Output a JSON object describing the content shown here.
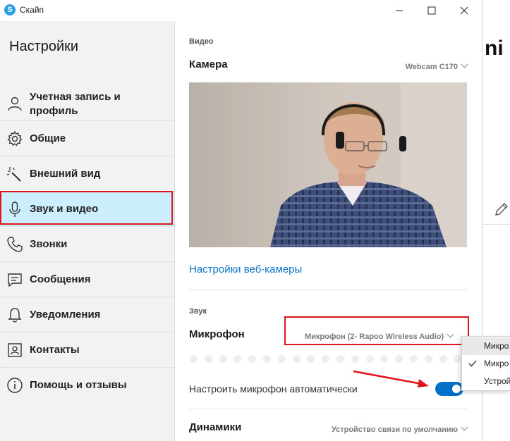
{
  "window": {
    "title": "Скайп",
    "app_icon_letter": "S"
  },
  "sidebar": {
    "title": "Настройки",
    "items": [
      {
        "label_line1": "Учетная запись и",
        "label_line2": "профиль",
        "icon": "person-icon"
      },
      {
        "label": "Общие",
        "icon": "gear-icon"
      },
      {
        "label": "Внешний вид",
        "icon": "magic-wand-icon"
      },
      {
        "label": "Звук и видео",
        "icon": "microphone-icon",
        "active": true
      },
      {
        "label": "Звонки",
        "icon": "phone-icon"
      },
      {
        "label": "Сообщения",
        "icon": "message-icon"
      },
      {
        "label": "Уведомления",
        "icon": "bell-icon"
      },
      {
        "label": "Контакты",
        "icon": "contacts-icon"
      },
      {
        "label": "Помощь и отзывы",
        "icon": "info-icon"
      }
    ]
  },
  "main": {
    "video_section": "Видео",
    "camera_label": "Камера",
    "camera_value": "Webcam C170",
    "webcam_settings_link": "Настройки веб-камеры",
    "sound_section": "Звук",
    "mic_label": "Микрофон",
    "mic_value": "Микрофон (2- Rapoo Wireless Audio)",
    "mic_level_fraction": 0,
    "auto_mic_label": "Настроить микрофон автоматически",
    "auto_mic_enabled": true,
    "speakers_label": "Динамики",
    "speakers_value": "Устройство связи по умолчанию"
  },
  "right_panel": {
    "partial_text": "ni"
  },
  "mic_dropdown": {
    "items": [
      {
        "label": "Микро",
        "checked": false
      },
      {
        "label": "Микро",
        "checked": true
      },
      {
        "label": "Устрой",
        "checked": false
      }
    ]
  },
  "colors": {
    "accent": "#0070c9",
    "active_bg": "#cdeefd",
    "highlight_red": "#e0151c"
  }
}
